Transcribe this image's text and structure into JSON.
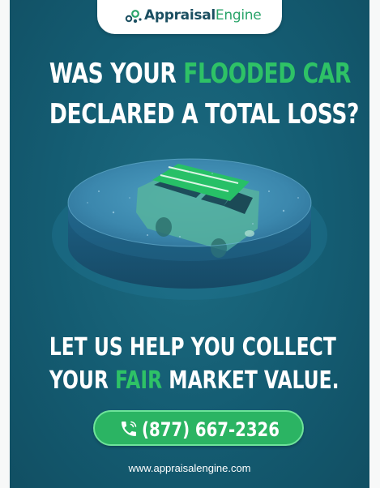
{
  "brand": {
    "name_part1": "Appraisal",
    "name_part2": "Engine",
    "icon": "logo-mark-icon"
  },
  "headline": {
    "line1_a": "WAS YOUR ",
    "line1_b": "FLOODED CAR",
    "line2": "DECLARED A TOTAL LOSS?"
  },
  "subhead": {
    "line1": "LET US HELP YOU COLLECT",
    "line2_a": "YOUR ",
    "line2_b": "FAIR",
    "line2_c": " MARKET VALUE."
  },
  "cta": {
    "phone": "(877) 667-2326",
    "icon": "phone-icon"
  },
  "footer": {
    "url": "www.appraisalengine.com"
  },
  "colors": {
    "background": "#145c72",
    "accent": "#2ec266",
    "button": "#2bb463",
    "text": "#ffffff",
    "brand_dark": "#1b4f61"
  }
}
